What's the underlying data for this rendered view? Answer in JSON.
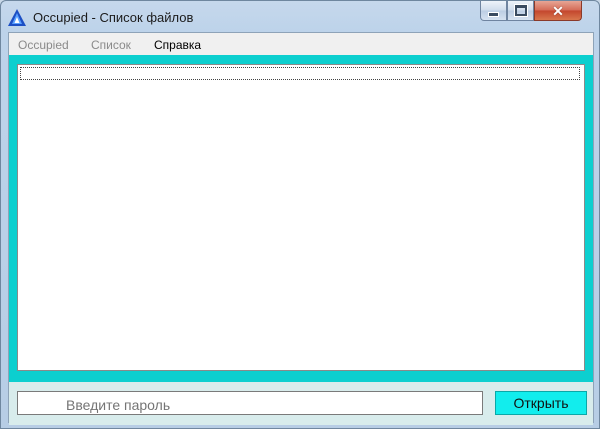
{
  "window": {
    "title": "Occupied - Список файлов",
    "icon": "occupied-app-icon",
    "controls": {
      "minimize_icon": "minimize-icon",
      "maximize_icon": "maximize-icon",
      "close_icon": "close-icon"
    }
  },
  "menu": {
    "items": [
      {
        "label": "Occupied",
        "enabled": false
      },
      {
        "label": "Список",
        "enabled": false
      },
      {
        "label": "Справка",
        "enabled": true
      }
    ]
  },
  "file_list": {
    "rows": []
  },
  "password": {
    "placeholder": "Введите пароль",
    "value": ""
  },
  "open_button": {
    "label": "Открыть"
  },
  "colors": {
    "accent": "#0ccfcf",
    "button": "#12eded",
    "text_prompt": "#1e1ea0"
  }
}
